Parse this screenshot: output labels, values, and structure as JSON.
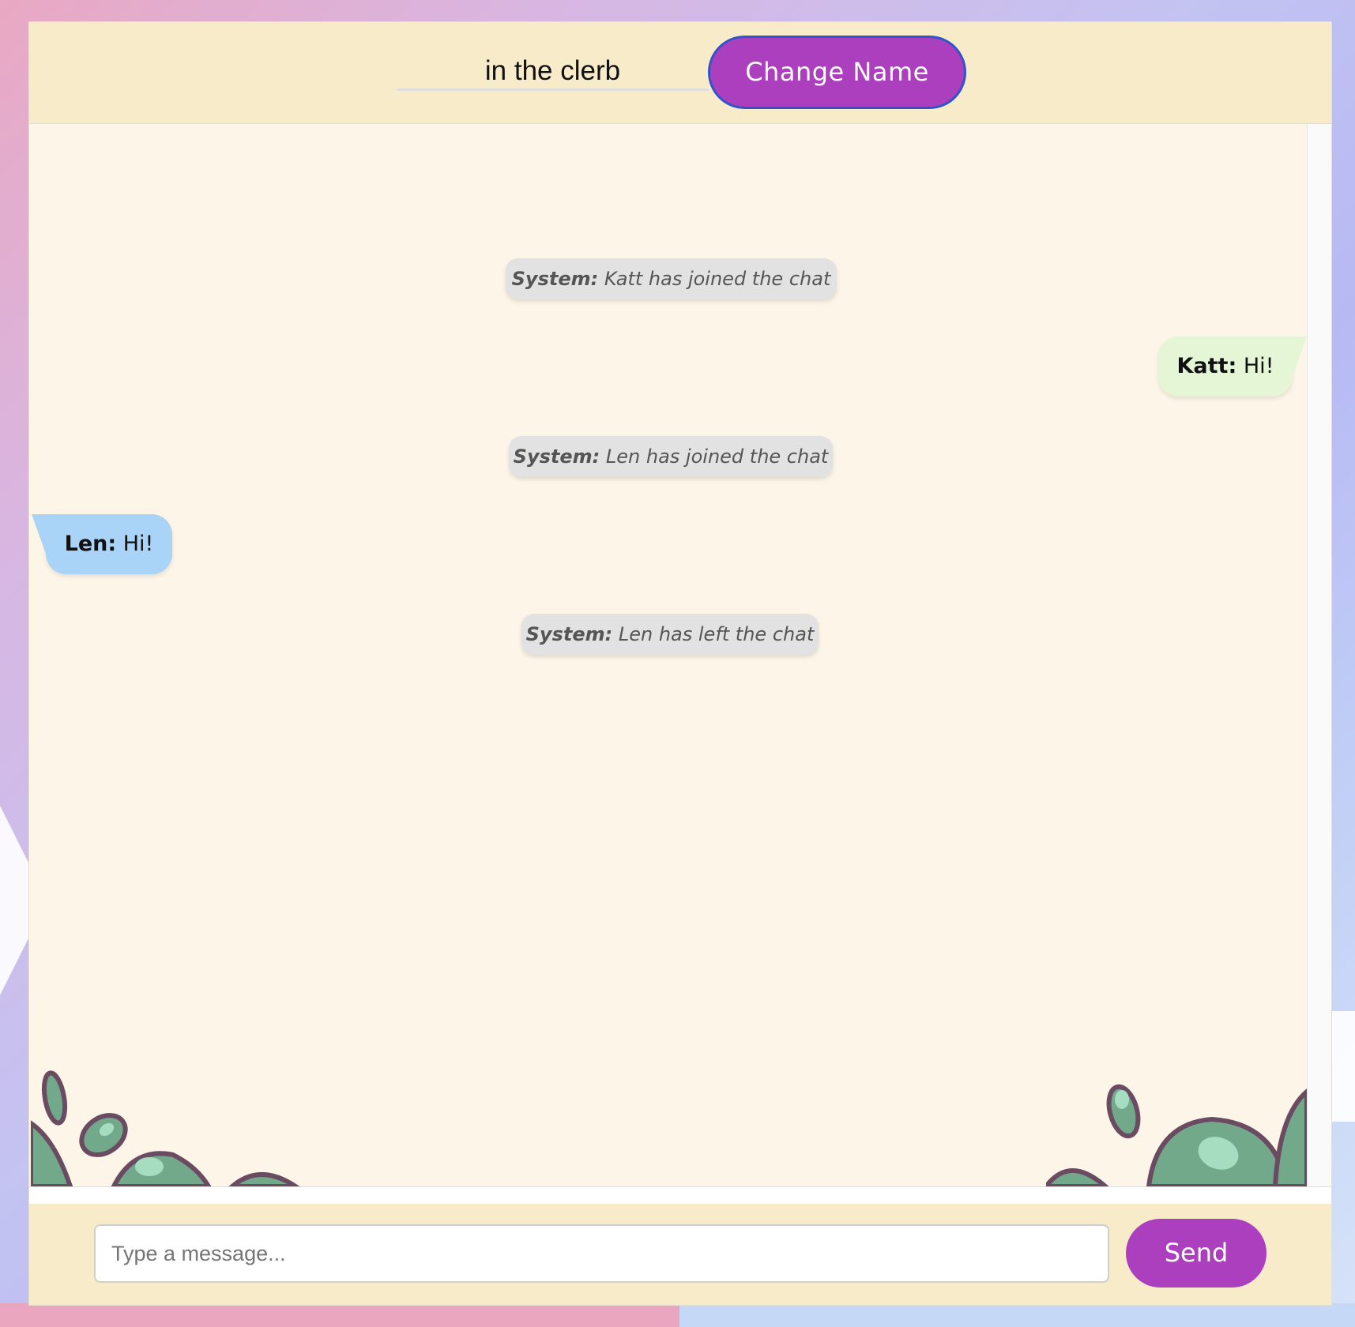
{
  "header": {
    "username": "in the clerb",
    "change_name_label": "Change Name"
  },
  "messages": [
    {
      "type": "system",
      "sender": "System:",
      "text": "Katt has joined the chat"
    },
    {
      "type": "self",
      "sender": "Katt:",
      "text": "Hi!"
    },
    {
      "type": "system",
      "sender": "System:",
      "text": "Len has joined the chat"
    },
    {
      "type": "other",
      "sender": "Len:",
      "text": "Hi!"
    },
    {
      "type": "system",
      "sender": "System:",
      "text": "Len has left the chat"
    }
  ],
  "composer": {
    "placeholder": "Type a message...",
    "send_label": "Send"
  },
  "colors": {
    "accent": "#ab3fbe",
    "header_bg": "#f8ebca",
    "chat_bg": "#fdf6e8",
    "self_bubble": "#e5f6d6",
    "other_bubble": "#a9d3f7",
    "system_bubble": "#e2e2e2"
  }
}
